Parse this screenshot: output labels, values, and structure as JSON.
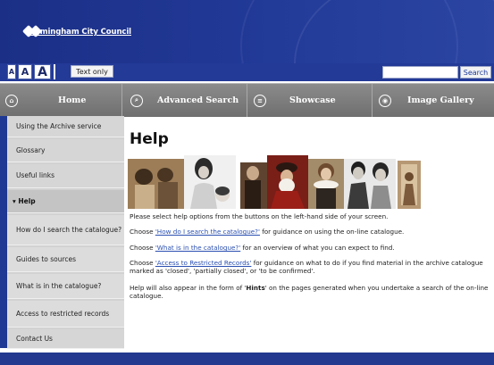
{
  "header": {
    "site_name": "Birmingham City Council"
  },
  "toolbar": {
    "text_size": [
      "A",
      "A",
      "A"
    ],
    "text_only": "Text only",
    "search_placeholder": "",
    "search_button": "Search"
  },
  "nav": {
    "items": [
      {
        "label": "Home",
        "icon": "home-icon"
      },
      {
        "label": "Advanced Search",
        "icon": "search-icon"
      },
      {
        "label": "Showcase",
        "icon": "list-icon"
      },
      {
        "label": "Image Gallery",
        "icon": "eye-icon"
      }
    ]
  },
  "sidebar": {
    "items": [
      {
        "label": "Using the Archive service"
      },
      {
        "label": "Glossary"
      },
      {
        "label": "Useful links"
      },
      {
        "label": "▾ Help"
      },
      {
        "label": "How do I search the catalogue?"
      },
      {
        "label": "Guides to sources"
      },
      {
        "label": "What is in the catalogue?"
      },
      {
        "label": "Access to restricted records"
      },
      {
        "label": "Contact Us"
      }
    ]
  },
  "main": {
    "title": "Help",
    "intro": "Please select help options from the buttons on the left-hand side of your screen.",
    "p1_pre": "Choose ",
    "p1_link": "'How do I search the catalogue?'",
    "p1_post": " for guidance on using the on-line catalogue.",
    "p2_pre": "Choose ",
    "p2_link": "'What is in the catalogue?'",
    "p2_post": " for an overview of what you can expect to find.",
    "p3_pre": "Choose ",
    "p3_link": "'Access to Restricted Records'",
    "p3_post": " for guidance on what to do if you find material in the archive catalogue marked as 'closed', 'partially closed', or 'to be confirmed'.",
    "p4_pre": "Help will also appear in the form of '",
    "p4_bold": "Hints",
    "p4_post": "' on the pages generated when you undertake a search of the on-line catalogue."
  },
  "colors": {
    "header": "#1f3791",
    "nav": "#7d7d7d",
    "sidebar": "#d2d2d2",
    "link": "#2a4fb0"
  }
}
